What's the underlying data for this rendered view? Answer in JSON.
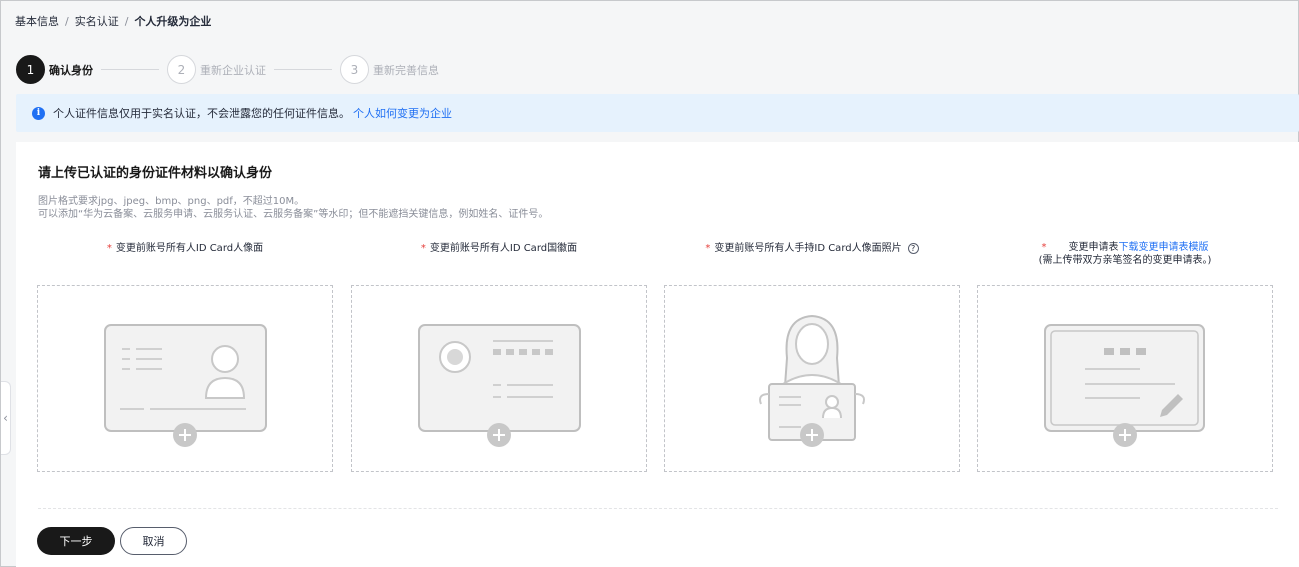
{
  "breadcrumb": {
    "items": [
      "基本信息",
      "实名认证",
      "个人升级为企业"
    ],
    "separator": "/"
  },
  "steps": [
    {
      "num": "1",
      "label": "确认身份",
      "active": true
    },
    {
      "num": "2",
      "label": "重新企业认证",
      "active": false
    },
    {
      "num": "3",
      "label": "重新完善信息",
      "active": false
    }
  ],
  "notice": {
    "text": "个人证件信息仅用于实名认证，不会泄露您的任何证件信息。",
    "link": "个人如何变更为企业",
    "icon": "info-icon"
  },
  "card": {
    "title": "请上传已认证的身份证件材料以确认身份",
    "hint_line1": "图片格式要求jpg、jpeg、bmp、png、pdf，不超过10M。",
    "hint_line2": "可以添加“华为云备案、云服务申请、云服务认证、云服务备案”等水印；但不能遮挡关键信息，例如姓名、证件号。"
  },
  "uploads": {
    "required_mark": "*",
    "front_label": "变更前账号所有人ID Card人像面",
    "back_label": "变更前账号所有人ID Card国徽面",
    "handheld_label": "变更前账号所有人手持ID Card人像面照片",
    "form_label": "变更申请表",
    "form_link": "下载变更申请表模版",
    "form_note": "(需上传带双方亲笔签名的变更申请表。)"
  },
  "buttons": {
    "next": "下一步",
    "cancel": "取消"
  },
  "colors": {
    "primary": "#191919",
    "link": "#2070f3",
    "notice_bg": "#e6f2fd",
    "required": "#e6403c"
  }
}
